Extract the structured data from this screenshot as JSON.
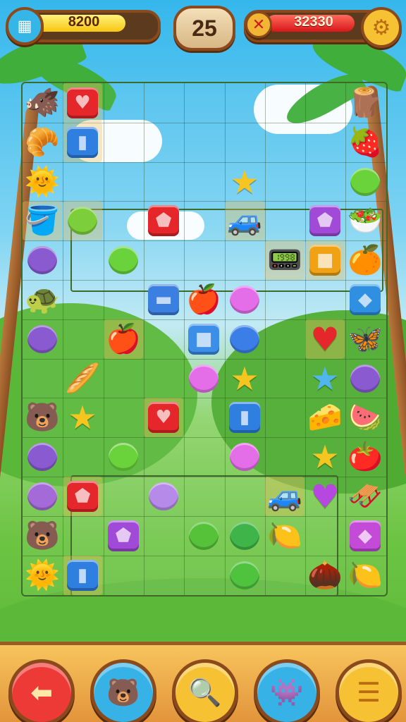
{
  "hud": {
    "score_left": "8200",
    "score_left_progress": 0.78,
    "moves": "25",
    "score_right": "32330",
    "score_right_progress": 0.82,
    "grid_icon": "grid-icon",
    "close_icon": "close-icon",
    "gear_icon": "gear-icon"
  },
  "board": {
    "rows": 13,
    "cols": 9,
    "tiles": [
      {
        "r": 0,
        "c": 0,
        "g": "🐗",
        "kind": "creature"
      },
      {
        "r": 0,
        "c": 1,
        "g": "♥",
        "kind": "block",
        "color": "#e5262a",
        "sel": true
      },
      {
        "r": 0,
        "c": 8,
        "g": "🪵",
        "kind": "item"
      },
      {
        "r": 1,
        "c": 0,
        "g": "🥐",
        "kind": "item"
      },
      {
        "r": 1,
        "c": 1,
        "g": "▮",
        "kind": "block",
        "color": "#2f7fe0",
        "sel": true
      },
      {
        "r": 1,
        "c": 8,
        "g": "🍓",
        "kind": "fruit"
      },
      {
        "r": 2,
        "c": 0,
        "g": "🌞",
        "kind": "creature"
      },
      {
        "r": 2,
        "c": 5,
        "g": "★",
        "kind": "star",
        "color": "#f7c520"
      },
      {
        "r": 2,
        "c": 8,
        "g": "●",
        "kind": "blob",
        "color": "#6ad33c"
      },
      {
        "r": 3,
        "c": 0,
        "g": "🪣",
        "kind": "item",
        "sel": true
      },
      {
        "r": 3,
        "c": 1,
        "g": "●",
        "kind": "blob",
        "color": "#7ccf3b",
        "sel": true
      },
      {
        "r": 3,
        "c": 3,
        "g": "⬟",
        "kind": "block",
        "color": "#e5262a"
      },
      {
        "r": 3,
        "c": 5,
        "g": "🚙",
        "kind": "item",
        "sel": true
      },
      {
        "r": 3,
        "c": 7,
        "g": "⬟",
        "kind": "block",
        "color": "#a24ad8"
      },
      {
        "r": 3,
        "c": 8,
        "g": "🥗",
        "kind": "item"
      },
      {
        "r": 4,
        "c": 0,
        "g": "●",
        "kind": "blob",
        "color": "#8a5ad0"
      },
      {
        "r": 4,
        "c": 2,
        "g": "●",
        "kind": "blob",
        "color": "#6ad33c"
      },
      {
        "r": 4,
        "c": 6,
        "g": "📟",
        "kind": "item",
        "sel": true
      },
      {
        "r": 4,
        "c": 7,
        "g": "■",
        "kind": "block",
        "color": "#f0a214",
        "sel": true
      },
      {
        "r": 4,
        "c": 8,
        "g": "🍊",
        "kind": "fruit"
      },
      {
        "r": 5,
        "c": 0,
        "g": "🐢",
        "kind": "creature"
      },
      {
        "r": 5,
        "c": 3,
        "g": "▬",
        "kind": "block",
        "color": "#3b7fe0"
      },
      {
        "r": 5,
        "c": 4,
        "g": "🍎",
        "kind": "fruit"
      },
      {
        "r": 5,
        "c": 5,
        "g": "●",
        "kind": "blob",
        "color": "#e46ee8"
      },
      {
        "r": 5,
        "c": 8,
        "g": "◆",
        "kind": "block",
        "color": "#2f8fe0"
      },
      {
        "r": 6,
        "c": 0,
        "g": "●",
        "kind": "blob",
        "color": "#8a5ad0"
      },
      {
        "r": 6,
        "c": 2,
        "g": "🍎",
        "kind": "fruit",
        "sel": true
      },
      {
        "r": 6,
        "c": 4,
        "g": "■",
        "kind": "block",
        "color": "#3c8fe8"
      },
      {
        "r": 6,
        "c": 5,
        "g": "●",
        "kind": "blob",
        "color": "#3c7ee8"
      },
      {
        "r": 6,
        "c": 7,
        "g": "♥",
        "kind": "heart",
        "color": "#e5262a",
        "sel": true
      },
      {
        "r": 6,
        "c": 8,
        "g": "🦋",
        "kind": "item"
      },
      {
        "r": 7,
        "c": 1,
        "g": "🥖",
        "kind": "item"
      },
      {
        "r": 7,
        "c": 4,
        "g": "●",
        "kind": "blob",
        "color": "#e46ee8"
      },
      {
        "r": 7,
        "c": 5,
        "g": "★",
        "kind": "star",
        "color": "#f7c520"
      },
      {
        "r": 7,
        "c": 7,
        "g": "★",
        "kind": "star",
        "color": "#4fb6ee"
      },
      {
        "r": 7,
        "c": 8,
        "g": "●",
        "kind": "blob",
        "color": "#8a5ad0"
      },
      {
        "r": 8,
        "c": 0,
        "g": "🐻",
        "kind": "creature"
      },
      {
        "r": 8,
        "c": 1,
        "g": "★",
        "kind": "star",
        "color": "#f7c520"
      },
      {
        "r": 8,
        "c": 3,
        "g": "♥",
        "kind": "block",
        "color": "#e5262a",
        "sel": true
      },
      {
        "r": 8,
        "c": 5,
        "g": "▮",
        "kind": "block",
        "color": "#2f7fe0"
      },
      {
        "r": 8,
        "c": 7,
        "g": "🧀",
        "kind": "item"
      },
      {
        "r": 8,
        "c": 8,
        "g": "🍉",
        "kind": "fruit"
      },
      {
        "r": 9,
        "c": 0,
        "g": "●",
        "kind": "blob",
        "color": "#8a5ad0"
      },
      {
        "r": 9,
        "c": 2,
        "g": "●",
        "kind": "blob",
        "color": "#6ad33c"
      },
      {
        "r": 9,
        "c": 5,
        "g": "●",
        "kind": "blob",
        "color": "#e46ee8"
      },
      {
        "r": 9,
        "c": 7,
        "g": "★",
        "kind": "star",
        "color": "#f7c520"
      },
      {
        "r": 9,
        "c": 8,
        "g": "🍅",
        "kind": "fruit"
      },
      {
        "r": 10,
        "c": 0,
        "g": "●",
        "kind": "blob",
        "color": "#a36ad8"
      },
      {
        "r": 10,
        "c": 1,
        "g": "⬟",
        "kind": "block",
        "color": "#e5262a",
        "sel": true
      },
      {
        "r": 10,
        "c": 3,
        "g": "●",
        "kind": "blob",
        "color": "#b58ae8"
      },
      {
        "r": 10,
        "c": 6,
        "g": "🚙",
        "kind": "item",
        "sel": true
      },
      {
        "r": 10,
        "c": 7,
        "g": "♥",
        "kind": "heart",
        "color": "#b647e0"
      },
      {
        "r": 10,
        "c": 8,
        "g": "🛷",
        "kind": "item"
      },
      {
        "r": 11,
        "c": 0,
        "g": "🐻",
        "kind": "creature"
      },
      {
        "r": 11,
        "c": 2,
        "g": "⬟",
        "kind": "block",
        "color": "#a24ad8"
      },
      {
        "r": 11,
        "c": 4,
        "g": "●",
        "kind": "blob",
        "color": "#56c23a"
      },
      {
        "r": 11,
        "c": 5,
        "g": "●",
        "kind": "blob",
        "color": "#3fb448"
      },
      {
        "r": 11,
        "c": 6,
        "g": "🍋",
        "kind": "fruit"
      },
      {
        "r": 11,
        "c": 8,
        "g": "◆",
        "kind": "block",
        "color": "#c44ad8"
      },
      {
        "r": 12,
        "c": 0,
        "g": "🌞",
        "kind": "creature"
      },
      {
        "r": 12,
        "c": 1,
        "g": "▮",
        "kind": "block",
        "color": "#2f7fe0",
        "sel": true
      },
      {
        "r": 12,
        "c": 5,
        "g": "●",
        "kind": "blob",
        "color": "#4fc23e"
      },
      {
        "r": 12,
        "c": 7,
        "g": "🌰",
        "kind": "item"
      },
      {
        "r": 12,
        "c": 8,
        "g": "🍋",
        "kind": "fruit"
      }
    ]
  },
  "bottom_bar": {
    "buttons": [
      {
        "name": "back-button",
        "icon": "arrow-left-icon",
        "glyph": "⬅",
        "bg": "#ee3a36",
        "fg": "#ffe9a8"
      },
      {
        "name": "creature-button",
        "icon": "creature-icon",
        "glyph": "🐻",
        "bg": "#36b2e6",
        "fg": "#5a2c0c"
      },
      {
        "name": "search-button",
        "icon": "magnifier-icon",
        "glyph": "🔍",
        "bg": "#f6c233",
        "fg": "#b86b10"
      },
      {
        "name": "hint-button",
        "icon": "creature-hint-icon",
        "glyph": "👾",
        "bg": "#36b2e6",
        "fg": "#7a4ac8"
      },
      {
        "name": "menu-button",
        "icon": "menu-icon",
        "glyph": "☰",
        "bg": "#f6c233",
        "fg": "#b86b10"
      }
    ]
  }
}
